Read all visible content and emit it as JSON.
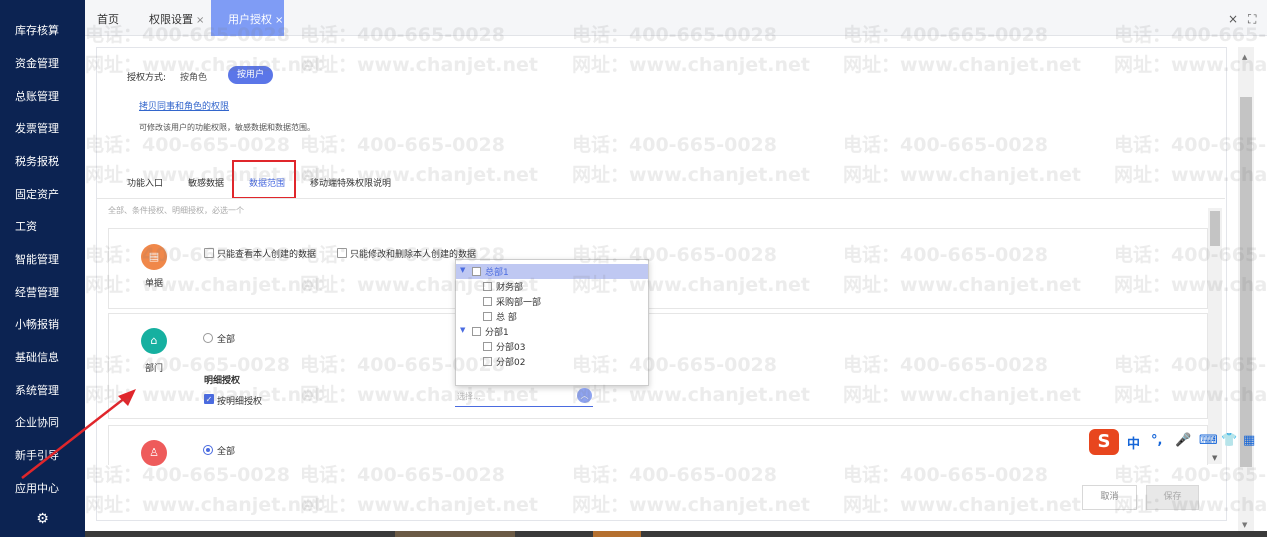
{
  "sidebar": {
    "items": [
      {
        "label": "库存核算"
      },
      {
        "label": "资金管理"
      },
      {
        "label": "总账管理"
      },
      {
        "label": "发票管理"
      },
      {
        "label": "税务报税"
      },
      {
        "label": "固定资产"
      },
      {
        "label": "工资"
      },
      {
        "label": "智能管理"
      },
      {
        "label": "经营管理"
      },
      {
        "label": "小畅报销"
      },
      {
        "label": "基础信息"
      },
      {
        "label": "系统管理"
      },
      {
        "label": "企业协同"
      },
      {
        "label": "新手引导"
      },
      {
        "label": "应用中心"
      }
    ],
    "settings_icon": "gear-icon"
  },
  "tabs": {
    "home": "首页",
    "perm": "权限设置",
    "user_auth": "用户授权",
    "close": "×"
  },
  "window": {
    "close": "×",
    "fullscreen": "⛶"
  },
  "auth": {
    "mode_label": "授权方式:",
    "by_role": "按角色",
    "by_user": "按用户",
    "copy_link": "拷贝同事和角色的权限",
    "description": "可修改该用户的功能权限，敏感数据和数据范围。"
  },
  "subtabs": {
    "function": "功能入口",
    "sensitive": "敏感数据",
    "scope": "数据范围",
    "mobile": "移动端特殊权限说明"
  },
  "hint": "全部、条件授权、明细授权，必选一个",
  "cards": {
    "doc": {
      "label": "单据",
      "only_view_own": "只能查看本人创建的数据",
      "only_edit_own": "只能修改和删除本人创建的数据"
    },
    "dept": {
      "label": "部门",
      "all": "全部",
      "detail_title": "明细授权",
      "by_detail": "按明细授权"
    },
    "third": {
      "all": "全部"
    }
  },
  "tree": {
    "nodes": [
      {
        "label": "总部1",
        "level": 0,
        "expanded": true,
        "highlighted": true
      },
      {
        "label": "财务部",
        "level": 1
      },
      {
        "label": "采购部一部",
        "level": 1
      },
      {
        "label": "总 部",
        "level": 1
      },
      {
        "label": "分部1",
        "level": 0,
        "expanded": true
      },
      {
        "label": "分部03",
        "level": 1
      },
      {
        "label": "分部02",
        "level": 1
      }
    ]
  },
  "select": {
    "placeholder": "选择..."
  },
  "footer": {
    "cancel": "取消",
    "save": "保存"
  },
  "ime": {
    "logo": "S",
    "items": [
      "中",
      "°,",
      "🎤",
      "⌨",
      "👕",
      "▦"
    ]
  },
  "watermark": {
    "phone": "电话：400-665-0028",
    "site": "网址：www.chanjet.net"
  },
  "colors": {
    "sidebar_bg": "#0c2352",
    "accent": "#5b76e8",
    "active_tab": "#7f9cf5",
    "annotation_red": "#e0262b"
  }
}
